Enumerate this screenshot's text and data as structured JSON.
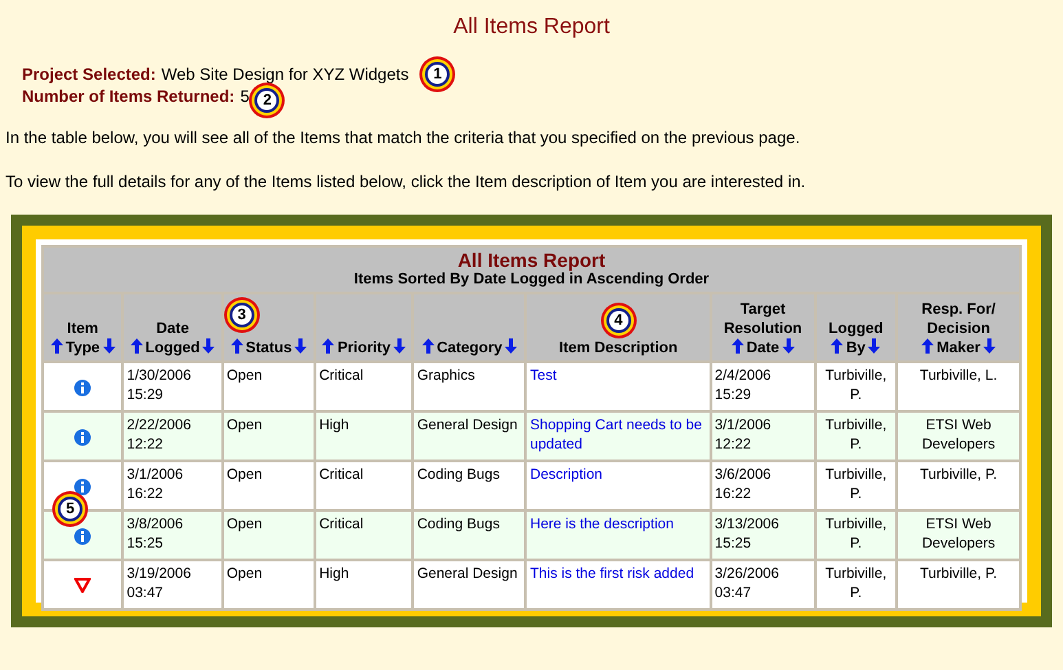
{
  "page_title": "All Items Report",
  "summary": [
    {
      "label": "Project Selected:",
      "value": "Web Site Design for XYZ Widgets"
    },
    {
      "label": "Number of Items Returned:",
      "value": "5"
    }
  ],
  "paragraphs": [
    "In the table below, you will see all of the Items that match the criteria that you specified on the previous page.",
    "To view the full details for any of the Items listed below, click the Item description of Item you are interested in."
  ],
  "callouts": [
    {
      "label": "1"
    },
    {
      "label": "2"
    },
    {
      "label": "3"
    },
    {
      "label": "4"
    },
    {
      "label": "5"
    }
  ],
  "table": {
    "title": "All Items Report",
    "subtitle": "Items Sorted By Date Logged in Ascending Order",
    "columns": [
      {
        "lines": [
          "Item",
          "Type"
        ],
        "sortable": true
      },
      {
        "lines": [
          "Date",
          "Logged"
        ],
        "sortable": true
      },
      {
        "lines": [
          "Status"
        ],
        "sortable": true
      },
      {
        "lines": [
          "Priority"
        ],
        "sortable": true
      },
      {
        "lines": [
          "Category"
        ],
        "sortable": true
      },
      {
        "lines": [
          "Item Description"
        ],
        "sortable": false
      },
      {
        "lines": [
          "Target",
          "Resolution",
          "Date"
        ],
        "sortable": true
      },
      {
        "lines": [
          "Logged",
          "By"
        ],
        "sortable": true
      },
      {
        "lines": [
          "Resp. For/",
          "Decision",
          "Maker"
        ],
        "sortable": true
      }
    ],
    "rows": [
      {
        "kind": "info",
        "date_logged": [
          "1/30/2006",
          "15:29"
        ],
        "status": "Open",
        "priority": "Critical",
        "category": "Graphics",
        "description": "Test",
        "target_date": [
          "2/4/2006",
          "15:29"
        ],
        "logged_by": [
          "Turbiville,",
          "P."
        ],
        "responsible": [
          "Turbiville, L."
        ]
      },
      {
        "kind": "info",
        "date_logged": [
          "2/22/2006",
          "12:22"
        ],
        "status": "Open",
        "priority": "High",
        "category": "General Design",
        "description": "Shopping Cart needs to be updated",
        "target_date": [
          "3/1/2006",
          "12:22"
        ],
        "logged_by": [
          "Turbiville,",
          "P."
        ],
        "responsible": [
          "ETSI Web",
          "Developers"
        ]
      },
      {
        "kind": "info",
        "date_logged": [
          "3/1/2006",
          "16:22"
        ],
        "status": "Open",
        "priority": "Critical",
        "category": "Coding Bugs",
        "description": "Description",
        "target_date": [
          "3/6/2006",
          "16:22"
        ],
        "logged_by": [
          "Turbiville,",
          "P."
        ],
        "responsible": [
          "Turbiville, P."
        ]
      },
      {
        "kind": "info",
        "date_logged": [
          "3/8/2006",
          "15:25"
        ],
        "status": "Open",
        "priority": "Critical",
        "category": "Coding Bugs",
        "description": "Here is the description",
        "target_date": [
          "3/13/2006",
          "15:25"
        ],
        "logged_by": [
          "Turbiville,",
          "P."
        ],
        "responsible": [
          "ETSI Web",
          "Developers"
        ]
      },
      {
        "kind": "risk",
        "date_logged": [
          "3/19/2006",
          "03:47"
        ],
        "status": "Open",
        "priority": "High",
        "category": "General Design",
        "description": "This is the first risk added",
        "target_date": [
          "3/26/2006",
          "03:47"
        ],
        "logged_by": [
          "Turbiville,",
          "P."
        ],
        "responsible": [
          "Turbiville, P."
        ]
      }
    ]
  }
}
